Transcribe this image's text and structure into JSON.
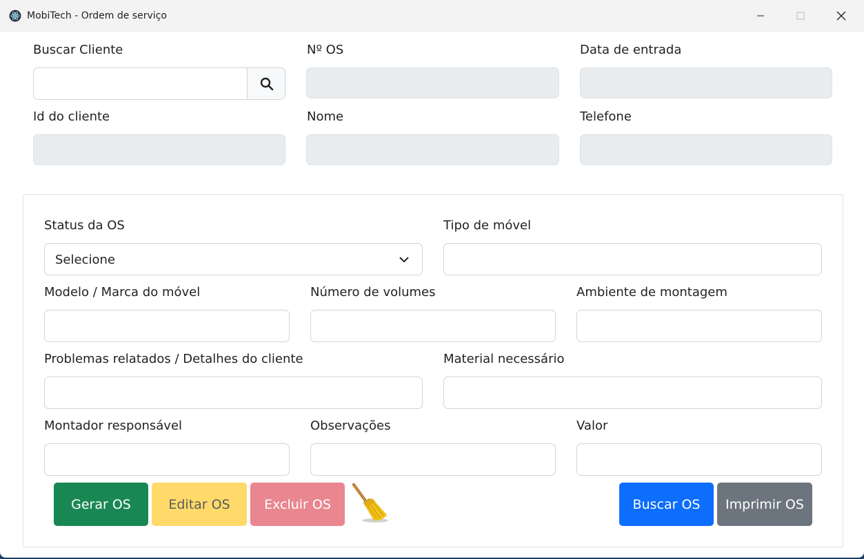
{
  "window": {
    "title": "MobiTech - Ordem de serviço"
  },
  "client_section": {
    "search_label": "Buscar Cliente",
    "search_value": "",
    "os_number_label": "Nº OS",
    "entry_date_label": "Data de entrada",
    "client_id_label": "Id do cliente",
    "name_label": "Nome",
    "phone_label": "Telefone"
  },
  "os_form": {
    "status_label": "Status da OS",
    "status_selected": "Selecione",
    "furniture_type_label": "Tipo de móvel",
    "model_label": "Modelo / Marca do móvel",
    "volumes_label": "Número de volumes",
    "room_label": "Ambiente de montagem",
    "problems_label": "Problemas relatados / Detalhes do cliente",
    "material_label": "Material necessário",
    "assembler_label": "Montador responsável",
    "notes_label": "Observações",
    "value_label": "Valor"
  },
  "buttons": {
    "generate": "Gerar OS",
    "edit": "Editar OS",
    "delete": "Excluir OS",
    "search": "Buscar OS",
    "print": "Imprimir OS"
  },
  "colors": {
    "generate": "#198754",
    "edit": "#ffda6a",
    "delete": "#ea868f",
    "search": "#0d6efd",
    "print": "#6c757d",
    "readonly_field": "#e9ecef"
  },
  "icons": {
    "app": "electron-atom-icon",
    "search": "search-icon",
    "clear": "broom-icon",
    "select": "chevron-down-icon"
  }
}
